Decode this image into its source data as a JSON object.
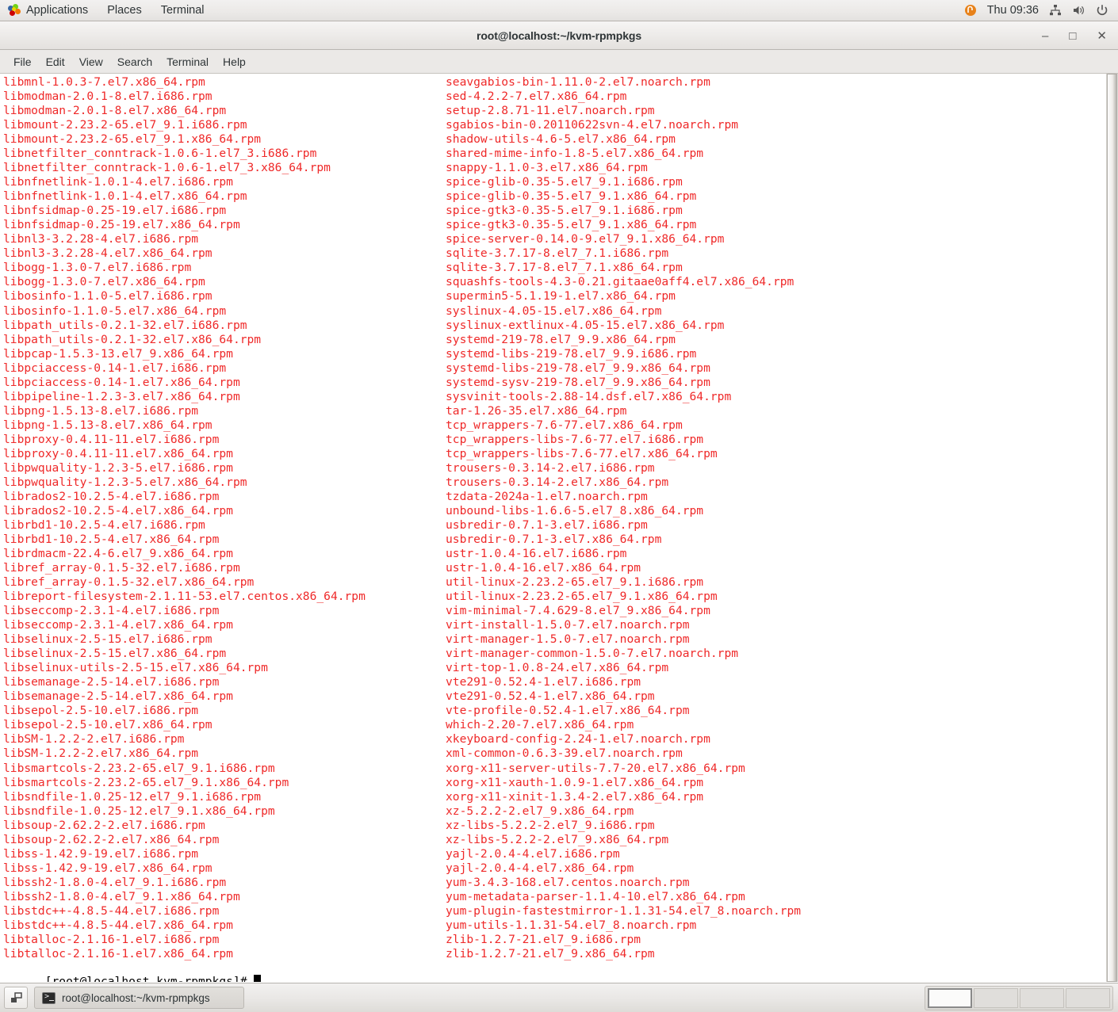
{
  "top_panel": {
    "applications_label": "Applications",
    "places_label": "Places",
    "terminal_label": "Terminal",
    "clock": "Thu 09:36",
    "icons": [
      "gnome-foot-icon",
      "fedora-orange-icon",
      "network-icon",
      "volume-icon",
      "power-icon"
    ]
  },
  "window": {
    "title": "root@localhost:~/kvm-rpmpkgs",
    "minimize_label": "–",
    "maximize_label": "□",
    "close_label": "✕"
  },
  "menubar": {
    "items": [
      {
        "label": "File"
      },
      {
        "label": "Edit"
      },
      {
        "label": "View"
      },
      {
        "label": "Search"
      },
      {
        "label": "Terminal"
      },
      {
        "label": "Help"
      }
    ]
  },
  "terminal": {
    "prompt": "[root@localhost kvm-rpmpkgs]# ",
    "text_color": "#ef2929",
    "prompt_color": "#000000",
    "background": "#ffffff",
    "column1": [
      "libmnl-1.0.3-7.el7.x86_64.rpm",
      "libmodman-2.0.1-8.el7.i686.rpm",
      "libmodman-2.0.1-8.el7.x86_64.rpm",
      "libmount-2.23.2-65.el7_9.1.i686.rpm",
      "libmount-2.23.2-65.el7_9.1.x86_64.rpm",
      "libnetfilter_conntrack-1.0.6-1.el7_3.i686.rpm",
      "libnetfilter_conntrack-1.0.6-1.el7_3.x86_64.rpm",
      "libnfnetlink-1.0.1-4.el7.i686.rpm",
      "libnfnetlink-1.0.1-4.el7.x86_64.rpm",
      "libnfsidmap-0.25-19.el7.i686.rpm",
      "libnfsidmap-0.25-19.el7.x86_64.rpm",
      "libnl3-3.2.28-4.el7.i686.rpm",
      "libnl3-3.2.28-4.el7.x86_64.rpm",
      "libogg-1.3.0-7.el7.i686.rpm",
      "libogg-1.3.0-7.el7.x86_64.rpm",
      "libosinfo-1.1.0-5.el7.i686.rpm",
      "libosinfo-1.1.0-5.el7.x86_64.rpm",
      "libpath_utils-0.2.1-32.el7.i686.rpm",
      "libpath_utils-0.2.1-32.el7.x86_64.rpm",
      "libpcap-1.5.3-13.el7_9.x86_64.rpm",
      "libpciaccess-0.14-1.el7.i686.rpm",
      "libpciaccess-0.14-1.el7.x86_64.rpm",
      "libpipeline-1.2.3-3.el7.x86_64.rpm",
      "libpng-1.5.13-8.el7.i686.rpm",
      "libpng-1.5.13-8.el7.x86_64.rpm",
      "libproxy-0.4.11-11.el7.i686.rpm",
      "libproxy-0.4.11-11.el7.x86_64.rpm",
      "libpwquality-1.2.3-5.el7.i686.rpm",
      "libpwquality-1.2.3-5.el7.x86_64.rpm",
      "librados2-10.2.5-4.el7.i686.rpm",
      "librados2-10.2.5-4.el7.x86_64.rpm",
      "librbd1-10.2.5-4.el7.i686.rpm",
      "librbd1-10.2.5-4.el7.x86_64.rpm",
      "librdmacm-22.4-6.el7_9.x86_64.rpm",
      "libref_array-0.1.5-32.el7.i686.rpm",
      "libref_array-0.1.5-32.el7.x86_64.rpm",
      "libreport-filesystem-2.1.11-53.el7.centos.x86_64.rpm",
      "libseccomp-2.3.1-4.el7.i686.rpm",
      "libseccomp-2.3.1-4.el7.x86_64.rpm",
      "libselinux-2.5-15.el7.i686.rpm",
      "libselinux-2.5-15.el7.x86_64.rpm",
      "libselinux-utils-2.5-15.el7.x86_64.rpm",
      "libsemanage-2.5-14.el7.i686.rpm",
      "libsemanage-2.5-14.el7.x86_64.rpm",
      "libsepol-2.5-10.el7.i686.rpm",
      "libsepol-2.5-10.el7.x86_64.rpm",
      "libSM-1.2.2-2.el7.i686.rpm",
      "libSM-1.2.2-2.el7.x86_64.rpm",
      "libsmartcols-2.23.2-65.el7_9.1.i686.rpm",
      "libsmartcols-2.23.2-65.el7_9.1.x86_64.rpm",
      "libsndfile-1.0.25-12.el7_9.1.i686.rpm",
      "libsndfile-1.0.25-12.el7_9.1.x86_64.rpm",
      "libsoup-2.62.2-2.el7.i686.rpm",
      "libsoup-2.62.2-2.el7.x86_64.rpm",
      "libss-1.42.9-19.el7.i686.rpm",
      "libss-1.42.9-19.el7.x86_64.rpm",
      "libssh2-1.8.0-4.el7_9.1.i686.rpm",
      "libssh2-1.8.0-4.el7_9.1.x86_64.rpm",
      "libstdc++-4.8.5-44.el7.i686.rpm",
      "libstdc++-4.8.5-44.el7.x86_64.rpm",
      "libtalloc-2.1.16-1.el7.i686.rpm",
      "libtalloc-2.1.16-1.el7.x86_64.rpm"
    ],
    "column2": [
      "seavgabios-bin-1.11.0-2.el7.noarch.rpm",
      "sed-4.2.2-7.el7.x86_64.rpm",
      "setup-2.8.71-11.el7.noarch.rpm",
      "sgabios-bin-0.20110622svn-4.el7.noarch.rpm",
      "shadow-utils-4.6-5.el7.x86_64.rpm",
      "shared-mime-info-1.8-5.el7.x86_64.rpm",
      "snappy-1.1.0-3.el7.x86_64.rpm",
      "spice-glib-0.35-5.el7_9.1.i686.rpm",
      "spice-glib-0.35-5.el7_9.1.x86_64.rpm",
      "spice-gtk3-0.35-5.el7_9.1.i686.rpm",
      "spice-gtk3-0.35-5.el7_9.1.x86_64.rpm",
      "spice-server-0.14.0-9.el7_9.1.x86_64.rpm",
      "sqlite-3.7.17-8.el7_7.1.i686.rpm",
      "sqlite-3.7.17-8.el7_7.1.x86_64.rpm",
      "squashfs-tools-4.3-0.21.gitaae0aff4.el7.x86_64.rpm",
      "supermin5-5.1.19-1.el7.x86_64.rpm",
      "syslinux-4.05-15.el7.x86_64.rpm",
      "syslinux-extlinux-4.05-15.el7.x86_64.rpm",
      "systemd-219-78.el7_9.9.x86_64.rpm",
      "systemd-libs-219-78.el7_9.9.i686.rpm",
      "systemd-libs-219-78.el7_9.9.x86_64.rpm",
      "systemd-sysv-219-78.el7_9.9.x86_64.rpm",
      "sysvinit-tools-2.88-14.dsf.el7.x86_64.rpm",
      "tar-1.26-35.el7.x86_64.rpm",
      "tcp_wrappers-7.6-77.el7.x86_64.rpm",
      "tcp_wrappers-libs-7.6-77.el7.i686.rpm",
      "tcp_wrappers-libs-7.6-77.el7.x86_64.rpm",
      "trousers-0.3.14-2.el7.i686.rpm",
      "trousers-0.3.14-2.el7.x86_64.rpm",
      "tzdata-2024a-1.el7.noarch.rpm",
      "unbound-libs-1.6.6-5.el7_8.x86_64.rpm",
      "usbredir-0.7.1-3.el7.i686.rpm",
      "usbredir-0.7.1-3.el7.x86_64.rpm",
      "ustr-1.0.4-16.el7.i686.rpm",
      "ustr-1.0.4-16.el7.x86_64.rpm",
      "util-linux-2.23.2-65.el7_9.1.i686.rpm",
      "util-linux-2.23.2-65.el7_9.1.x86_64.rpm",
      "vim-minimal-7.4.629-8.el7_9.x86_64.rpm",
      "virt-install-1.5.0-7.el7.noarch.rpm",
      "virt-manager-1.5.0-7.el7.noarch.rpm",
      "virt-manager-common-1.5.0-7.el7.noarch.rpm",
      "virt-top-1.0.8-24.el7.x86_64.rpm",
      "vte291-0.52.4-1.el7.i686.rpm",
      "vte291-0.52.4-1.el7.x86_64.rpm",
      "vte-profile-0.52.4-1.el7.x86_64.rpm",
      "which-2.20-7.el7.x86_64.rpm",
      "xkeyboard-config-2.24-1.el7.noarch.rpm",
      "xml-common-0.6.3-39.el7.noarch.rpm",
      "xorg-x11-server-utils-7.7-20.el7.x86_64.rpm",
      "xorg-x11-xauth-1.0.9-1.el7.x86_64.rpm",
      "xorg-x11-xinit-1.3.4-2.el7.x86_64.rpm",
      "xz-5.2.2-2.el7_9.x86_64.rpm",
      "xz-libs-5.2.2-2.el7_9.i686.rpm",
      "xz-libs-5.2.2-2.el7_9.x86_64.rpm",
      "yajl-2.0.4-4.el7.i686.rpm",
      "yajl-2.0.4-4.el7.x86_64.rpm",
      "yum-3.4.3-168.el7.centos.noarch.rpm",
      "yum-metadata-parser-1.1.4-10.el7.x86_64.rpm",
      "yum-plugin-fastestmirror-1.1.31-54.el7_8.noarch.rpm",
      "yum-utils-1.1.31-54.el7_8.noarch.rpm",
      "zlib-1.2.7-21.el7_9.i686.rpm",
      "zlib-1.2.7-21.el7_9.x86_64.rpm"
    ]
  },
  "bottom_panel": {
    "show_desktop_icon": "show-desktop-icon",
    "task_button_label": "root@localhost:~/kvm-rpmpkgs",
    "workspaces": [
      {
        "name": "workspace-1",
        "active": true
      },
      {
        "name": "workspace-2",
        "active": false
      },
      {
        "name": "workspace-3",
        "active": false
      },
      {
        "name": "workspace-4",
        "active": false
      }
    ]
  }
}
